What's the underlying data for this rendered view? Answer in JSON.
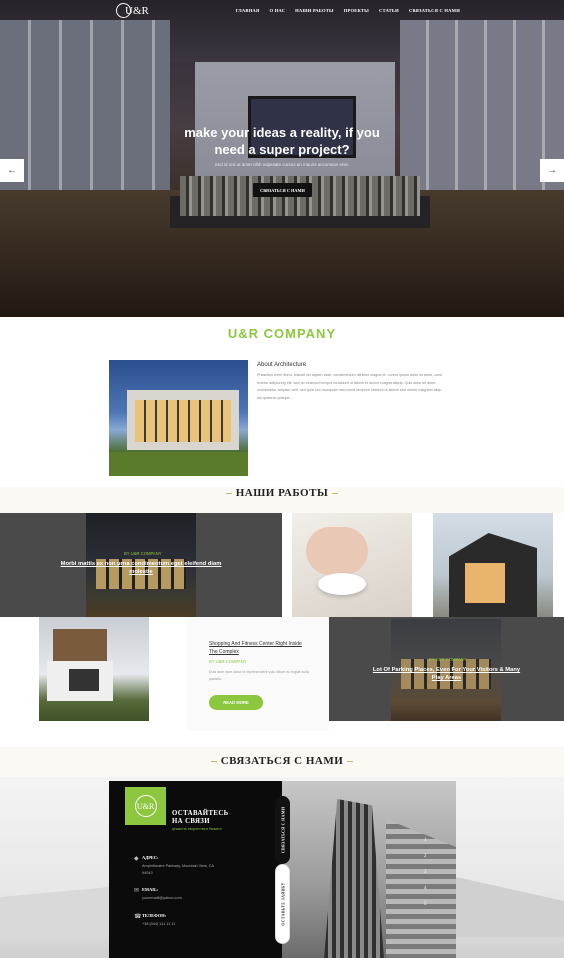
{
  "nav": {
    "logo": "U&R",
    "menu": [
      "ГЛАВНАЯ",
      "О НАС",
      "НАШИ РАБОТЫ",
      "ПРОЕКТЫ",
      "СТАТЬИ",
      "СВЯЗАТЬСЯ С НАМИ"
    ]
  },
  "hero": {
    "title": "make your ideas a reality, if you need a super project?",
    "subtitle": "Sed id nisi ut amet nibh vulputate cursus an mauris accumsan enin.",
    "button": "СВЯЗАТЬСЯ С НАМИ",
    "prev_icon": "arrow-left-icon",
    "next_icon": "arrow-right-icon"
  },
  "company": {
    "title": "U&R COMPANY",
    "about_heading": "About Architecture",
    "about_text": "Phasellus enim libero, blandit vel sapien vitae, condimentum ultricies magna et. Lorem ipsum dolor sit amet, cons ectetur adipiscing elit, sed do eiusmod tempor incididunt ut labore et dolore magna aliqua. Quis dolor sit amet, consectetur, adipisci velit, sed quia non numquam eius modi tempora incidunt ut labore etut dolore magnam aliqu am quaerat quisque..."
  },
  "works": {
    "title": "НАШИ РАБОТЫ",
    "tile1": {
      "tag": "BY U&R COMPANY",
      "caption": "Morbi mattis ex non urna condimentum eget eleifend diam molestie"
    },
    "tile5": {
      "caption": "Shopping And Fitness Center Right Inside The Complex",
      "tag": "BY U&R COMPANY",
      "text": "Duis aute irure dolor in reprehenderit volu ddore eu fugiat nulla pariatur.",
      "button": "READ MORE"
    },
    "tile6": {
      "tag": "BY U&R COMPANY",
      "caption": "Lot Of Parking Places, Even For Your Visitors & Many Play Areas"
    }
  },
  "contact": {
    "title": "СВЯЗАТЬСЯ С НАМИ",
    "logo": "U&R",
    "heading": "ОСТАВАЙТЕСЬ НА СВЯЗИ",
    "slogan": "ценность творчества в бизнесе",
    "address_label": "АДРЕС:",
    "address": "Amphitheatre Parkway, Mountain View, CA 94043",
    "email_label": "EMAIL:",
    "email": "youremaill@yahoo.com",
    "phone_label": "ТЕЛЕФОН:",
    "phone": "+38 (044) 111 11 11",
    "tab_active": "СВЯЗАТЬСЯ С НАМИ",
    "tab_inactive": "ОСТАВЬТЕ ЗАЯВКУ",
    "pager": [
      "1",
      "2",
      "3",
      "4",
      "5"
    ]
  }
}
